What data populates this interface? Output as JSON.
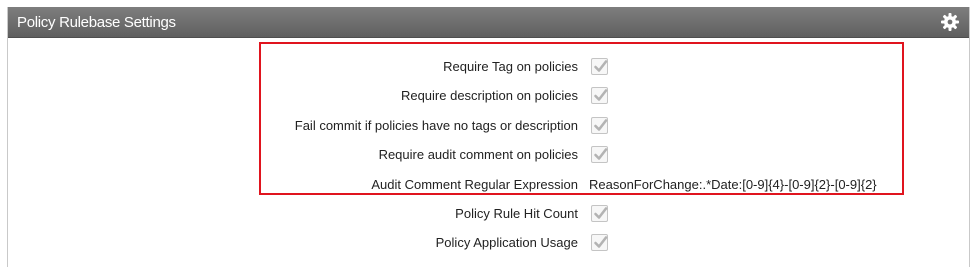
{
  "panel": {
    "title": "Policy Rulebase Settings",
    "settings_icon": "gear-icon"
  },
  "settings": [
    {
      "label": "Require Tag on policies",
      "type": "checkbox",
      "checked": true
    },
    {
      "label": "Require description on policies",
      "type": "checkbox",
      "checked": true
    },
    {
      "label": "Fail commit if policies have no tags or description",
      "type": "checkbox",
      "checked": true
    },
    {
      "label": "Require audit comment on policies",
      "type": "checkbox",
      "checked": true
    },
    {
      "label": "Audit Comment Regular Expression",
      "type": "text",
      "value": "ReasonForChange:.*Date:[0-9]{4}-[0-9]{2}-[0-9]{2}"
    },
    {
      "label": "Policy Rule Hit Count",
      "type": "checkbox",
      "checked": true
    },
    {
      "label": "Policy Application Usage",
      "type": "checkbox",
      "checked": true
    }
  ],
  "colors": {
    "header_bg": "#6f6f6f",
    "highlight": "#e0141e",
    "check_mark": "#b3b3b3"
  }
}
